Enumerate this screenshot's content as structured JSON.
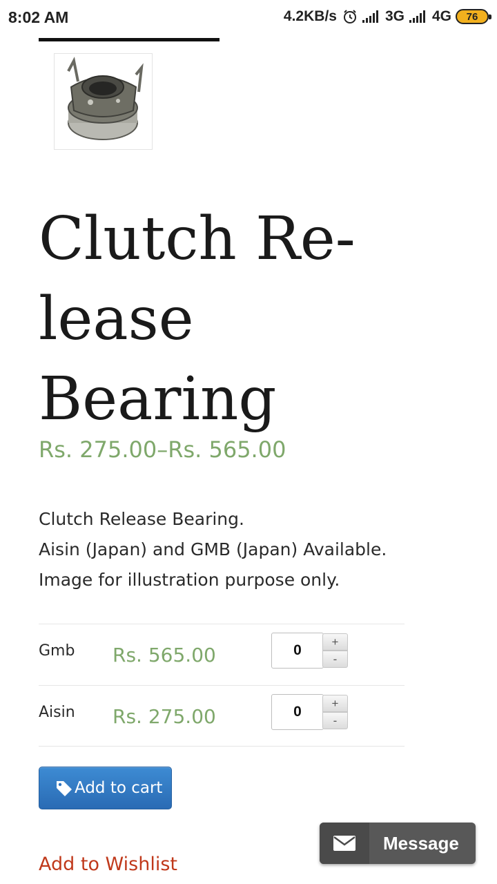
{
  "status_bar": {
    "time": "8:02 AM",
    "speed": "4.2KB/s",
    "net1": "3G",
    "net2": "4G",
    "battery": "76",
    "battery_color": "#f2b01e"
  },
  "product": {
    "image_alt": "clutch-release-bearing-image",
    "title": "Clutch Re-lease Bearing",
    "price_range": "Rs. 275.00–Rs. 565.00",
    "description": [
      "Clutch Release Bearing.",
      "Aisin (Japan) and GMB (Japan) Available.",
      "Image for illustration purpose only."
    ]
  },
  "variations": [
    {
      "name": "Gmb",
      "price": "Rs. 565.00",
      "qty": "0",
      "plus": "+",
      "minus": "-"
    },
    {
      "name": "Aisin",
      "price": "Rs. 275.00",
      "qty": "0",
      "plus": "+",
      "minus": "-"
    }
  ],
  "actions": {
    "add_to_cart": "Add to cart",
    "add_to_cart_icon": "tag-icon",
    "add_to_wishlist": "Add to Wishlist"
  },
  "message_widget": {
    "label": "Message",
    "icon": "envelope-icon"
  },
  "colors": {
    "price_green": "#7fa86b",
    "button_blue": "#2f74c0",
    "wishlist_red": "#c0391b",
    "message_bg": "#585858"
  }
}
